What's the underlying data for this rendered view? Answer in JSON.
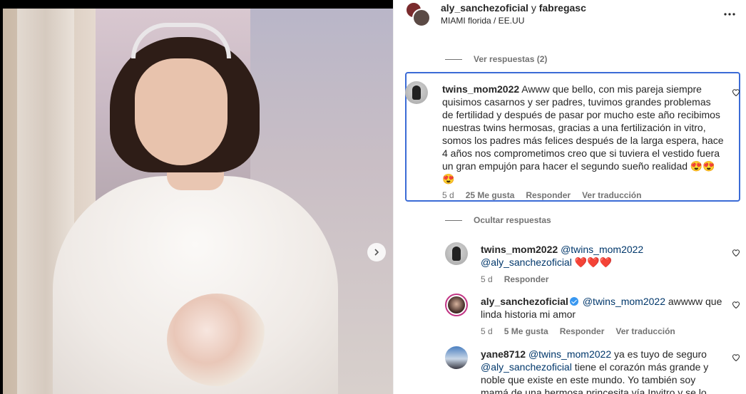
{
  "header": {
    "user1": "aly_sanchezoficial",
    "conjunction": "y",
    "user2": "fabregasc",
    "location": "MIAMI florida / EE.UU"
  },
  "view_replies": "Ver respuestas (2)",
  "hide_replies": "Ocultar respuestas",
  "main_comment": {
    "user": "twins_mom2022",
    "text": "Awww que bello, con mis pareja siempre quisimos casarnos y ser padres, tuvimos grandes problemas de fertilidad y después de pasar por mucho este año recibimos nuestras twins hermosas, gracias a una fertilización in vitro, somos los padres más felices después de la larga espera, hace 4 años nos comprometimos creo que si tuviera el vestido fuera un gran empujón para hacer el segundo sueño realidad 😍😍😍",
    "time": "5 d",
    "likes": "25 Me gusta",
    "reply": "Responder",
    "translate": "Ver traducción"
  },
  "reply1": {
    "user": "twins_mom2022",
    "mention1": "@twins_mom2022",
    "mention2": "@aly_sanchezoficial",
    "emoji": "❤️❤️❤️",
    "time": "5 d",
    "reply": "Responder"
  },
  "reply2": {
    "user": "aly_sanchezoficial",
    "mention": "@twins_mom2022",
    "text": "awwww que linda historia mi amor",
    "time": "5 d",
    "likes": "5 Me gusta",
    "reply": "Responder",
    "translate": "Ver traducción"
  },
  "reply3": {
    "user": "yane8712",
    "mention1": "@twins_mom2022",
    "text1": "ya es tuyo de seguro",
    "mention2": "@aly_sanchezoficial",
    "text2": "tiene el corazón más grande y noble que existe en este mundo. Yo también soy mamá de una hermosa princesita vía Invitro y se lo"
  },
  "icons": {
    "more": "more-horizontal-icon",
    "heart": "heart-outline-icon",
    "next": "chevron-right-icon",
    "verified": "verified-badge-icon"
  },
  "colors": {
    "highlight_border": "#3b6bd6",
    "mention": "#00376b",
    "secondary_text": "#737373"
  }
}
